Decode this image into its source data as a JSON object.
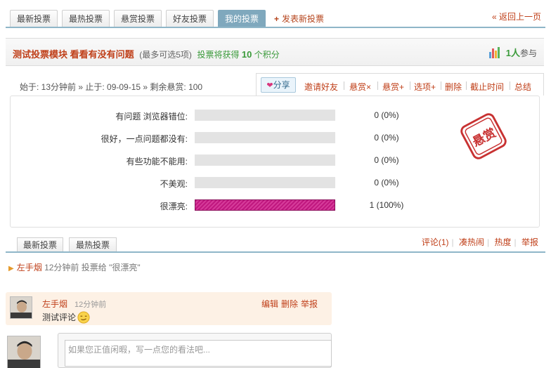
{
  "top_tabs": [
    {
      "label": "最新投票",
      "active": false
    },
    {
      "label": "最热投票",
      "active": false
    },
    {
      "label": "悬赏投票",
      "active": false
    },
    {
      "label": "好友投票",
      "active": false
    },
    {
      "label": "我的投票",
      "active": true
    }
  ],
  "new_poll_label": "发表新投票",
  "back_label": "« 返回上一页",
  "poll": {
    "title": "测试投票模块 看看有没有问题",
    "option_limit": "(最多可选5项)",
    "reward_prefix": "投票将获得",
    "reward_points": "10",
    "reward_suffix": "个积分",
    "participant_count": "1人",
    "participant_suffix": "参与",
    "info": "始于: 13分钟前 » 止于: 09-09-15 » 剩余悬赏: 100"
  },
  "actions": {
    "share": "分享",
    "invite": "邀请好友",
    "reward_remove": "悬赏×",
    "reward_add": "悬赏+",
    "option_add": "选项+",
    "delete": "删除",
    "deadline": "截止时间",
    "summary": "总结"
  },
  "options": [
    {
      "label": "有问题 浏览器错位:",
      "votes": "0 (0%)",
      "fraction": 0
    },
    {
      "label": "很好，一点问题都没有:",
      "votes": "0 (0%)",
      "fraction": 0
    },
    {
      "label": "有些功能不能用:",
      "votes": "0 (0%)",
      "fraction": 0
    },
    {
      "label": "不美观:",
      "votes": "0 (0%)",
      "fraction": 0
    },
    {
      "label": "很漂亮:",
      "votes": "1 (100%)",
      "fraction": 1
    }
  ],
  "stamp_text": "悬赏",
  "bottom_tabs": [
    {
      "label": "最新投票"
    },
    {
      "label": "最热投票"
    }
  ],
  "comment_links": {
    "comments": "评论(1)",
    "hot": "凑热闹",
    "heat": "热度",
    "report": "举报"
  },
  "vote_log": {
    "user": "左手烟",
    "text": "12分钟前 投票给 \"很漂亮\""
  },
  "comment": {
    "user": "左手烟",
    "time": "12分钟前",
    "edit": "编辑",
    "delete": "删除",
    "report": "举报",
    "text": "测试评论"
  },
  "reply": {
    "placeholder": "如果您正值闲暇，写一点您的看法吧..."
  },
  "colors": {
    "accent": "#c0401a",
    "tab_active": "#7fa8bd",
    "bar_fill": "#c0187f",
    "green": "#3a9a3a"
  }
}
